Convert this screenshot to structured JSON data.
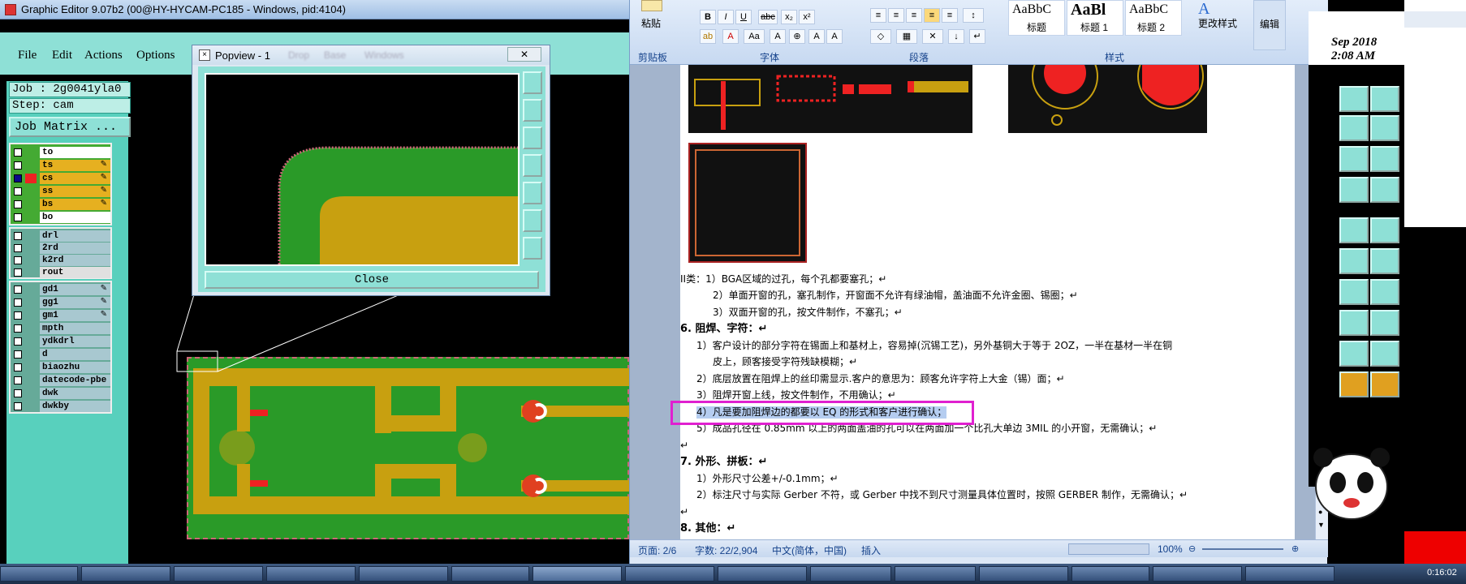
{
  "cam": {
    "title": "Graphic Editor 9.07b2 (00@HY-HYCAM-PC185 - Windows, pid:4104)",
    "menu": [
      "File",
      "Edit",
      "Actions",
      "Options"
    ],
    "job": "Job : 2g0041yla0",
    "step": "Step: cam",
    "job_matrix": "Job Matrix ...",
    "layers_group1": [
      {
        "name": "to",
        "color": "#ffffff"
      },
      {
        "name": "ts",
        "color": "#e6b020"
      },
      {
        "name": "cs",
        "color": "#e6b020"
      },
      {
        "name": "ss",
        "color": "#e6b020"
      },
      {
        "name": "bs",
        "color": "#e6b020"
      },
      {
        "name": "bo",
        "color": "#ffffff"
      }
    ],
    "layers_group2": [
      "drl",
      "2rd",
      "k2rd",
      "rout"
    ],
    "layers_group3": [
      "gd1",
      "gg1",
      "gm1",
      "mpth",
      "ydkdrl",
      "d",
      "biaozhu",
      "datecode-pbe",
      "dwk",
      "dwkby"
    ]
  },
  "popview": {
    "title": "Popview - 1",
    "menu_blurred": [
      "Drop",
      "Base",
      "Windows"
    ],
    "close_label": "Close"
  },
  "word": {
    "ribbon": {
      "paste_label": "粘贴",
      "group_clipboard": "剪贴板",
      "group_font": "字体",
      "group_paragraph": "段落",
      "group_styles": "样式",
      "styles": [
        {
          "preview": "AaBbC",
          "name": "标题"
        },
        {
          "preview": "AaBl",
          "name": "标题 1"
        },
        {
          "preview": "AaBbC",
          "name": "标题 2"
        }
      ],
      "change_styles": "更改样式",
      "edit": "编辑"
    },
    "doc_lines": [
      {
        "text": "II类：1）BGA区域的过孔，每个孔都要塞孔；↵",
        "head": false
      },
      {
        "text": "2）单面开窗的孔，塞孔制作，开窗面不允许有绿油帽，盖油面不允许金圈、锡圈；↵",
        "head": false
      },
      {
        "text": "3）双面开窗的孔，按文件制作，不塞孔；↵",
        "head": false
      },
      {
        "text": "6.   阻焊、字符：↵",
        "head": true
      },
      {
        "text": "1）客户设计的部分字符在锡面上和基材上，容易掉(沉锡工艺)，另外基铜大于等于 2OZ，一半在基材一半在铜",
        "head": false
      },
      {
        "text": "皮上，顾客接受字符残缺模糊；↵",
        "head": false
      },
      {
        "text": "2）底层放置在阻焊上的丝印需显示.客户的意思为：顾客允许字符上大金（锡）面；↵",
        "head": false
      },
      {
        "text": "3）阻焊开窗上线，按文件制作，不用确认；↵",
        "head": false
      },
      {
        "text": "4）凡是要加阻焊边的都要以 EQ 的形式和客户进行确认；",
        "head": false
      },
      {
        "text": "5）成品孔径在 0.85mm 以上的两面盖油的孔可以在两面加一个比孔大单边 3MIL 的小开窗，无需确认；↵",
        "head": false
      },
      {
        "text": "↵",
        "head": false
      },
      {
        "text": "7.   外形、拼板：↵",
        "head": true
      },
      {
        "text": "1）外形尺寸公差+/-0.1mm；↵",
        "head": false
      },
      {
        "text": "2）标注尺寸与实际 Gerber 不符，或 Gerber 中找不到尺寸测量具体位置时，按照 GERBER 制作，无需确认；↵",
        "head": false
      },
      {
        "text": "↵",
        "head": false
      },
      {
        "text": "8.   其他：↵",
        "head": true
      }
    ],
    "status": {
      "page": "页面: 2/6",
      "words": "字数: 22/2,904",
      "lang": "中文(简体，中国)",
      "mode": "插入",
      "zoom": "100%"
    }
  },
  "right": {
    "date_line1": "Sep 2018",
    "date_line2": "2:08 AM"
  },
  "taskbar": {
    "clock": "0:16:02"
  }
}
